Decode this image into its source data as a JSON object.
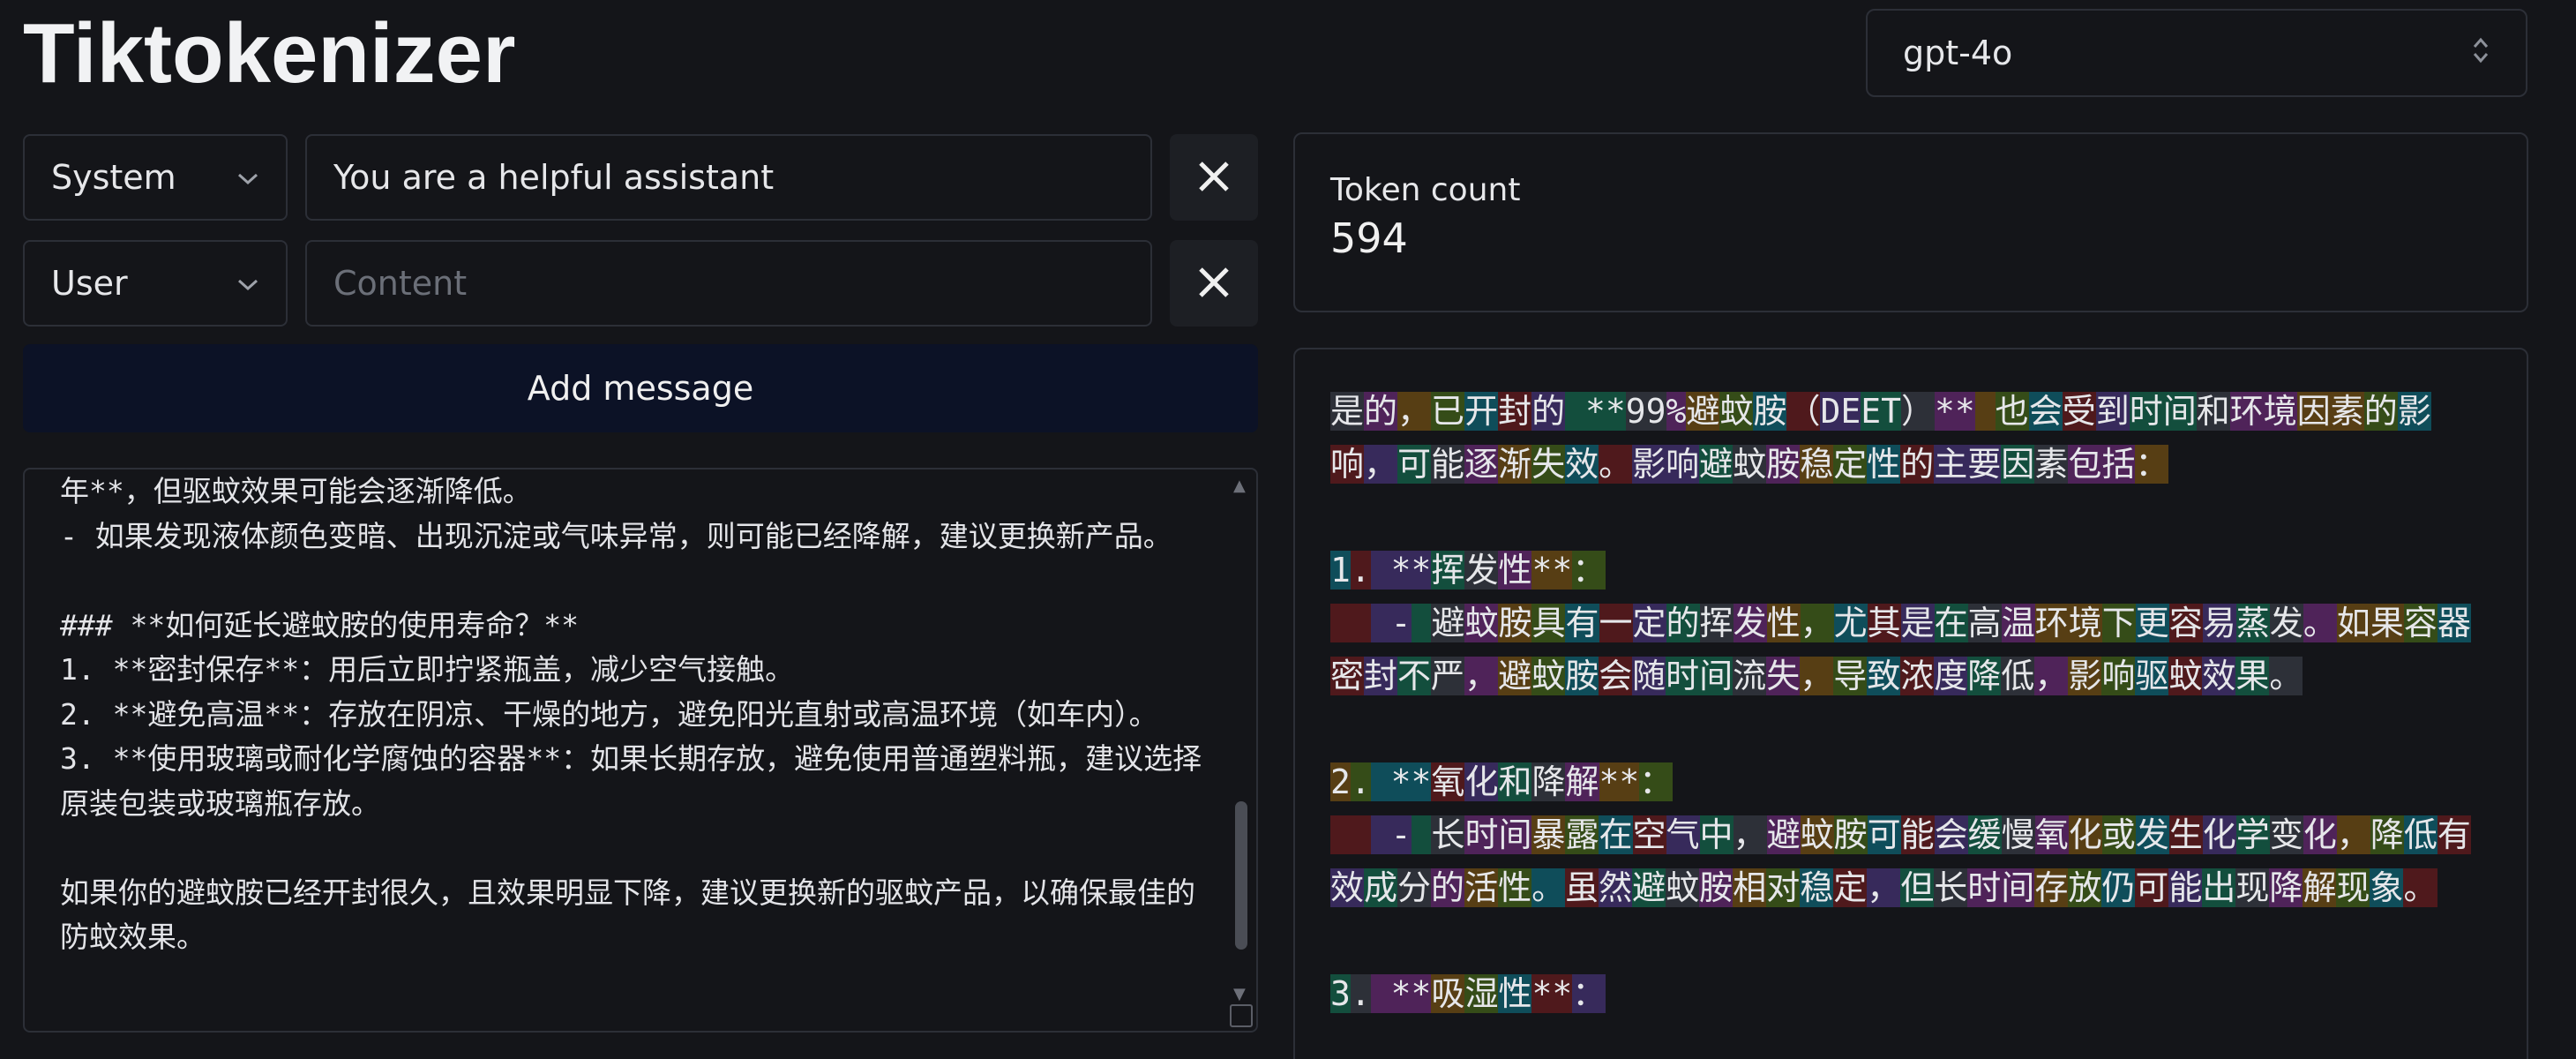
{
  "app": {
    "title": "Tiktokenizer"
  },
  "model": {
    "selected": "gpt-4o"
  },
  "messages": [
    {
      "role": "System",
      "content": "You are a helpful assistant",
      "placeholder": "Content"
    },
    {
      "role": "User",
      "content": "",
      "placeholder": "Content"
    }
  ],
  "add_message_label": "Add message",
  "editor": {
    "text": "年**，但驱蚊效果可能会逐渐降低。\n- 如果发现液体颜色变暗、出现沉淀或气味异常，则可能已经降解，建议更换新产品。\n\n### **如何延长避蚊胺的使用寿命？**\n1. **密封保存**：用后立即拧紧瓶盖，减少空气接触。\n2. **避免高温**：存放在阴凉、干燥的地方，避免阳光直射或高温环境（如车内）。\n3. **使用玻璃或耐化学腐蚀的容器**：如果长期存放，避免使用普通塑料瓶，建议选择原装包装或玻璃瓶存放。\n\n如果你的避蚊胺已经开封很久，且效果明显下降，建议更换新的驱蚊产品，以确保最佳的防蚊效果。"
  },
  "token_count": {
    "label": "Token count",
    "value": "594"
  },
  "tokens": [
    "是",
    "的",
    "，",
    "已",
    "开",
    "封",
    "的",
    " **",
    "99",
    "%",
    "避",
    "蚊",
    "胺",
    "（",
    "DE",
    "ET",
    "）",
    "**",
    " ",
    "也",
    "会",
    "受",
    "到",
    "时间",
    "和",
    "环境",
    "因素",
    "的",
    "影",
    "响",
    "，",
    "可",
    "能",
    "逐",
    "渐",
    "失",
    "效",
    "。",
    "影响",
    "避",
    "蚊",
    "胺",
    "稳",
    "定",
    "性",
    "的",
    "主要",
    "因",
    "素",
    "包括",
    "：",
    "\n\n",
    "1",
    ".",
    " **",
    "挥",
    "发",
    "性",
    "**",
    "：",
    "\n",
    "  ",
    " -",
    " ",
    "避",
    "蚊",
    "胺",
    "具",
    "有",
    "一",
    "定",
    "的",
    "挥",
    "发",
    "性",
    "，",
    "尤",
    "其",
    "是",
    "在",
    "高",
    "温",
    "环境",
    "下",
    "更",
    "容",
    "易",
    "蒸",
    "发",
    "。",
    "如果",
    "容",
    "器",
    "密",
    "封",
    "不",
    "严",
    "，",
    "避",
    "蚊",
    "胺",
    "会",
    "随",
    "时间",
    "流",
    "失",
    "，",
    "导",
    "致",
    "浓",
    "度",
    "降",
    "低",
    "，",
    "影",
    "响",
    "驱",
    "蚊",
    "效",
    "果",
    "。",
    "\n\n",
    "2",
    ".",
    " **",
    "氧",
    "化",
    "和",
    "降",
    "解",
    "**",
    "：",
    "\n",
    "  ",
    " -",
    " ",
    "长",
    "时间",
    "暴",
    "露",
    "在",
    "空",
    "气",
    "中",
    "，",
    "避",
    "蚊",
    "胺",
    "可",
    "能",
    "会",
    "缓",
    "慢",
    "氧",
    "化",
    "或",
    "发",
    "生",
    "化",
    "学",
    "变",
    "化",
    "，",
    "降",
    "低",
    "有",
    "效",
    "成",
    "分",
    "的",
    "活",
    "性",
    "。",
    "虽",
    "然",
    "避",
    "蚊",
    "胺",
    "相",
    "对",
    "稳",
    "定",
    "，",
    "但",
    "长",
    "时间",
    "存",
    "放",
    "仍",
    "可",
    "能",
    "出",
    "现",
    "降",
    "解",
    "现",
    "象",
    "。",
    "\n\n",
    "3",
    ".",
    " **",
    "吸",
    "湿",
    "性",
    "**",
    "：",
    "\n"
  ]
}
